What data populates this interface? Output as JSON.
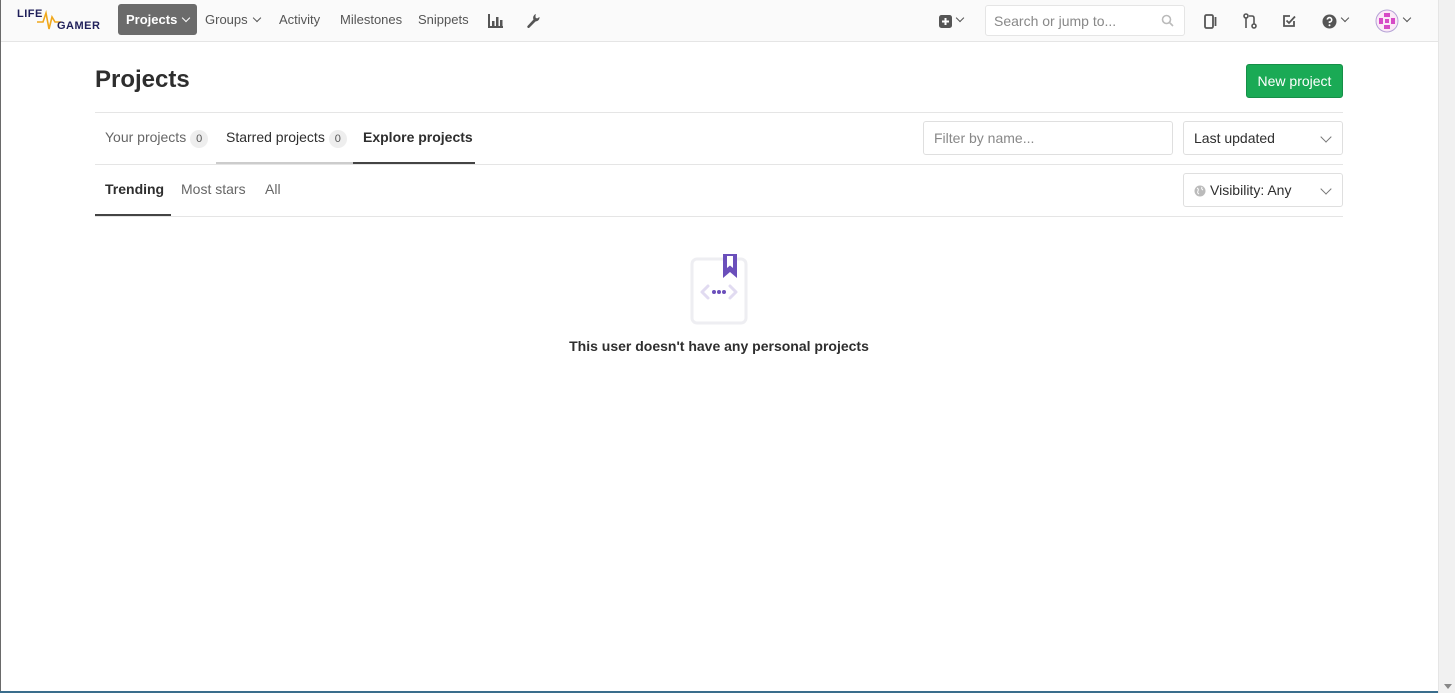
{
  "brand": {
    "line1": "LIFE",
    "line2": "GAMER"
  },
  "nav": {
    "projects": "Projects",
    "groups": "Groups",
    "activity": "Activity",
    "milestones": "Milestones",
    "snippets": "Snippets"
  },
  "search": {
    "placeholder": "Search or jump to..."
  },
  "page": {
    "title": "Projects",
    "new_project": "New project"
  },
  "tabs": {
    "your_projects": {
      "label": "Your projects",
      "count": "0"
    },
    "starred_projects": {
      "label": "Starred projects",
      "count": "0"
    },
    "explore_projects": {
      "label": "Explore projects"
    }
  },
  "filter": {
    "placeholder": "Filter by name..."
  },
  "sort": {
    "selected": "Last updated"
  },
  "subtabs": {
    "trending": "Trending",
    "most_stars": "Most stars",
    "all": "All"
  },
  "visibility": {
    "selected": "Visibility: Any"
  },
  "empty_state": {
    "message": "This user doesn't have any personal projects"
  },
  "colors": {
    "accent": "#1aaa55",
    "illustration": "#6b4fbb"
  }
}
